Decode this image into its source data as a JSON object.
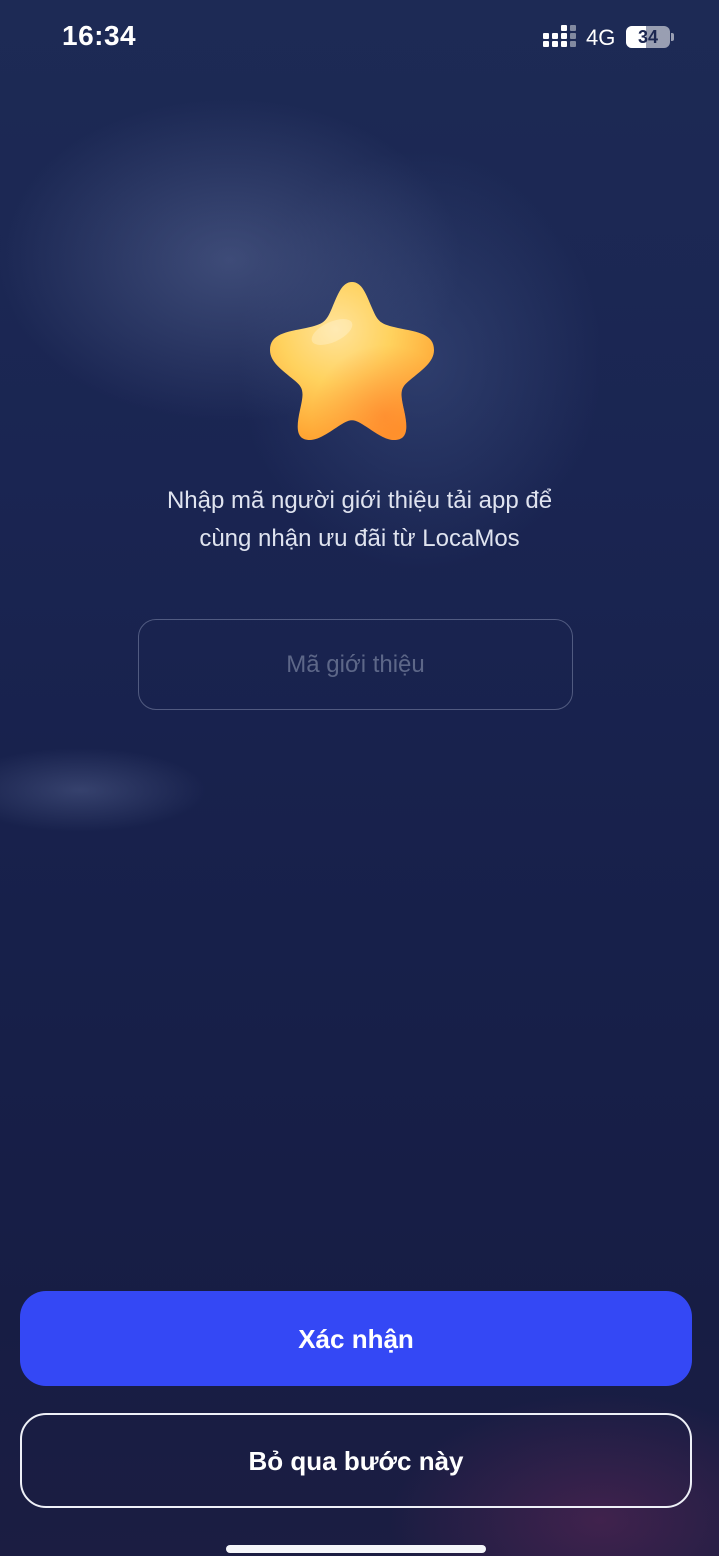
{
  "status_bar": {
    "time": "16:34",
    "network": "4G",
    "battery_level": "34"
  },
  "hero": {
    "icon": "star-icon",
    "message_line1": "Nhập mã người giới thiệu tải app để",
    "message_line2": "cùng nhận ưu đãi từ LocaMos"
  },
  "referral_form": {
    "placeholder": "Mã giới thiệu",
    "value": ""
  },
  "actions": {
    "confirm_label": "Xác nhận",
    "skip_label": "Bỏ qua bước này"
  },
  "colors": {
    "primary_button": "#3448f5",
    "background_top": "#1d2a55",
    "background_bottom": "#1b1d42",
    "star_yellow": "#ffd25e",
    "star_orange": "#ff9f2e"
  }
}
